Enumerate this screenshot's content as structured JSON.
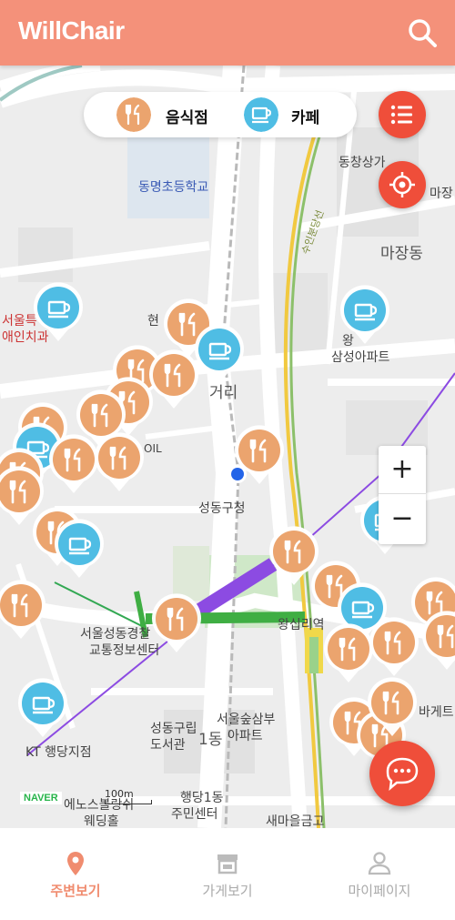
{
  "header": {
    "title": "WillChair",
    "search_icon": "search-icon"
  },
  "filter": {
    "restaurant_label": "음식점",
    "cafe_label": "카페"
  },
  "colors": {
    "brand": "#f4917a",
    "restaurant": "#eba46e",
    "cafe": "#4fbde4",
    "accent_red": "#ef4e3a"
  },
  "map": {
    "labels": {
      "school": "동명초등학교",
      "market": "동창상가",
      "majang_short": "마장",
      "majang_dong": "마장동",
      "line_name": "수인분당선",
      "seoul_special_1": "서울특",
      "seoul_special_2": "애인치과",
      "hyeon": "현",
      "samsung_apt_1": "왕",
      "samsung_apt_2": "삼성아파트",
      "georie": "거리",
      "oil": "OIL",
      "district_office": "성동구청",
      "police_1": "서울성동경찰",
      "police_2": "교통정보센터",
      "wangsimni": "왕십리역",
      "seoul_forest_1": "서울숲삼부",
      "seoul_forest_2": "아파트",
      "library_1": "성동구립",
      "library_2": "도서관",
      "dong_label": "1동",
      "kt": "KT 행당지점",
      "wedding_1": "에노스블랑쉬",
      "wedding_2": "웨딩홀",
      "community_1": "행당1동",
      "community_2": "주민센터",
      "credit_union": "새마을금고",
      "bakery": "바게트"
    },
    "naver_logo": "NAVER",
    "scale": "100m",
    "zoom_in": "+",
    "zoom_out": "−",
    "pins": [
      {
        "type": "cafe"
      },
      {
        "type": "restaurant"
      },
      {
        "type": "cafe"
      },
      {
        "type": "cafe"
      },
      {
        "type": "restaurant"
      },
      {
        "type": "restaurant"
      },
      {
        "type": "restaurant"
      },
      {
        "type": "restaurant"
      },
      {
        "type": "restaurant"
      },
      {
        "type": "cafe"
      },
      {
        "type": "restaurant"
      },
      {
        "type": "restaurant"
      },
      {
        "type": "restaurant"
      },
      {
        "type": "restaurant"
      },
      {
        "type": "restaurant"
      },
      {
        "type": "restaurant"
      },
      {
        "type": "cafe"
      },
      {
        "type": "restaurant"
      },
      {
        "type": "cafe"
      },
      {
        "type": "restaurant"
      },
      {
        "type": "restaurant"
      },
      {
        "type": "cafe"
      },
      {
        "type": "restaurant"
      },
      {
        "type": "restaurant"
      },
      {
        "type": "restaurant"
      },
      {
        "type": "restaurant"
      },
      {
        "type": "restaurant"
      },
      {
        "type": "cafe"
      },
      {
        "type": "restaurant"
      },
      {
        "type": "restaurant"
      },
      {
        "type": "restaurant"
      }
    ]
  },
  "nav": {
    "nearby": "주변보기",
    "stores": "가게보기",
    "mypage": "마이페이지"
  }
}
